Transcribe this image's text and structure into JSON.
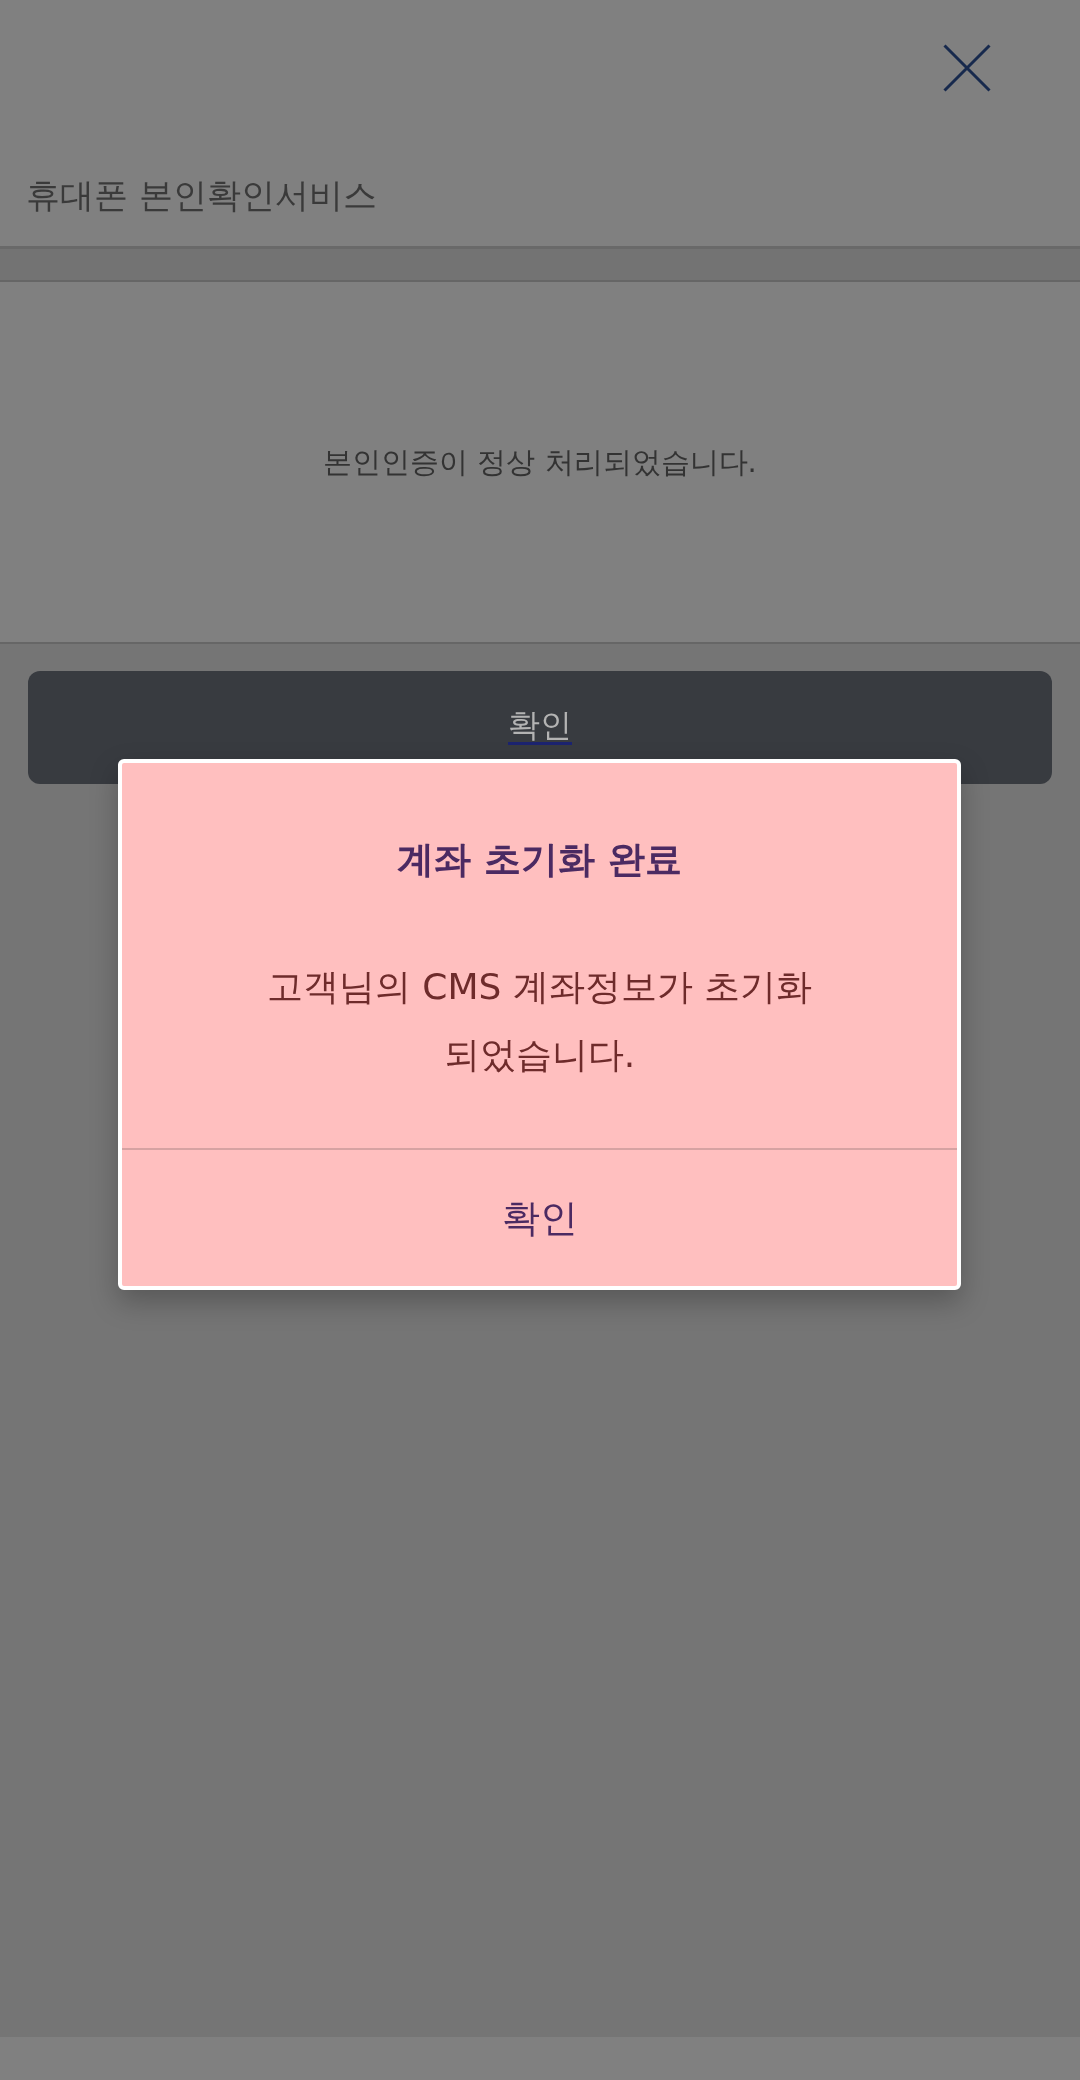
{
  "header": {
    "title": "휴대폰 본인확인서비스"
  },
  "message": "본인인증이 정상 처리되었습니다.",
  "confirm_button": {
    "label": "확인"
  },
  "dialog": {
    "title": "계좌 초기화 완료",
    "message": "고객님의 CMS 계좌정보가 초기화 되었습니다.",
    "button": "확인"
  }
}
